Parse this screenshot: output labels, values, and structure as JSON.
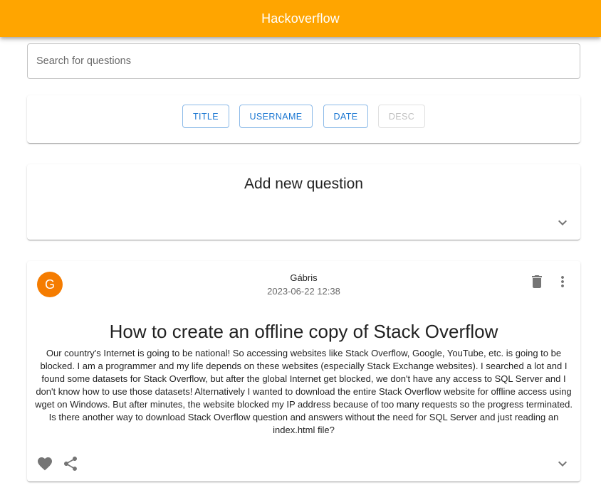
{
  "app": {
    "title": "Hackoverflow",
    "accent": "#ffa500"
  },
  "search": {
    "placeholder": "Search for questions",
    "value": ""
  },
  "sort": {
    "buttons": [
      {
        "label": "TITLE",
        "enabled": true
      },
      {
        "label": "USERNAME",
        "enabled": true
      },
      {
        "label": "DATE",
        "enabled": true
      },
      {
        "label": "DESC",
        "enabled": false
      }
    ]
  },
  "add_question": {
    "title": "Add new question",
    "expand_icon": "chevron-down-icon"
  },
  "question": {
    "avatar_letter": "G",
    "avatar_color": "#f57c00",
    "username": "Gábris",
    "date": "2023-06-22 12:38",
    "title": "How to create an offline copy of Stack Overflow",
    "body": "Our country's Internet is going to be national! So accessing websites like Stack Overflow, Google, YouTube, etc. is going to be blocked. I am a programmer and my life depends on these websites (especially Stack Exchange websites). I searched a lot and I found some datasets for Stack Overflow, but after the global Internet get blocked, we don't have any access to SQL Server and I don't know how to use those datasets! Alternatively I wanted to download the entire Stack Overflow website for offline access using wget on Windows. But after minutes, the website blocked my IP address because of too many requests so the progress terminated. Is there another way to download Stack Overflow question and answers without the need for SQL Server and just reading an index.html file?",
    "icons": [
      "delete-icon",
      "more-vert-icon",
      "heart-icon",
      "share-icon",
      "chevron-down-icon"
    ]
  }
}
